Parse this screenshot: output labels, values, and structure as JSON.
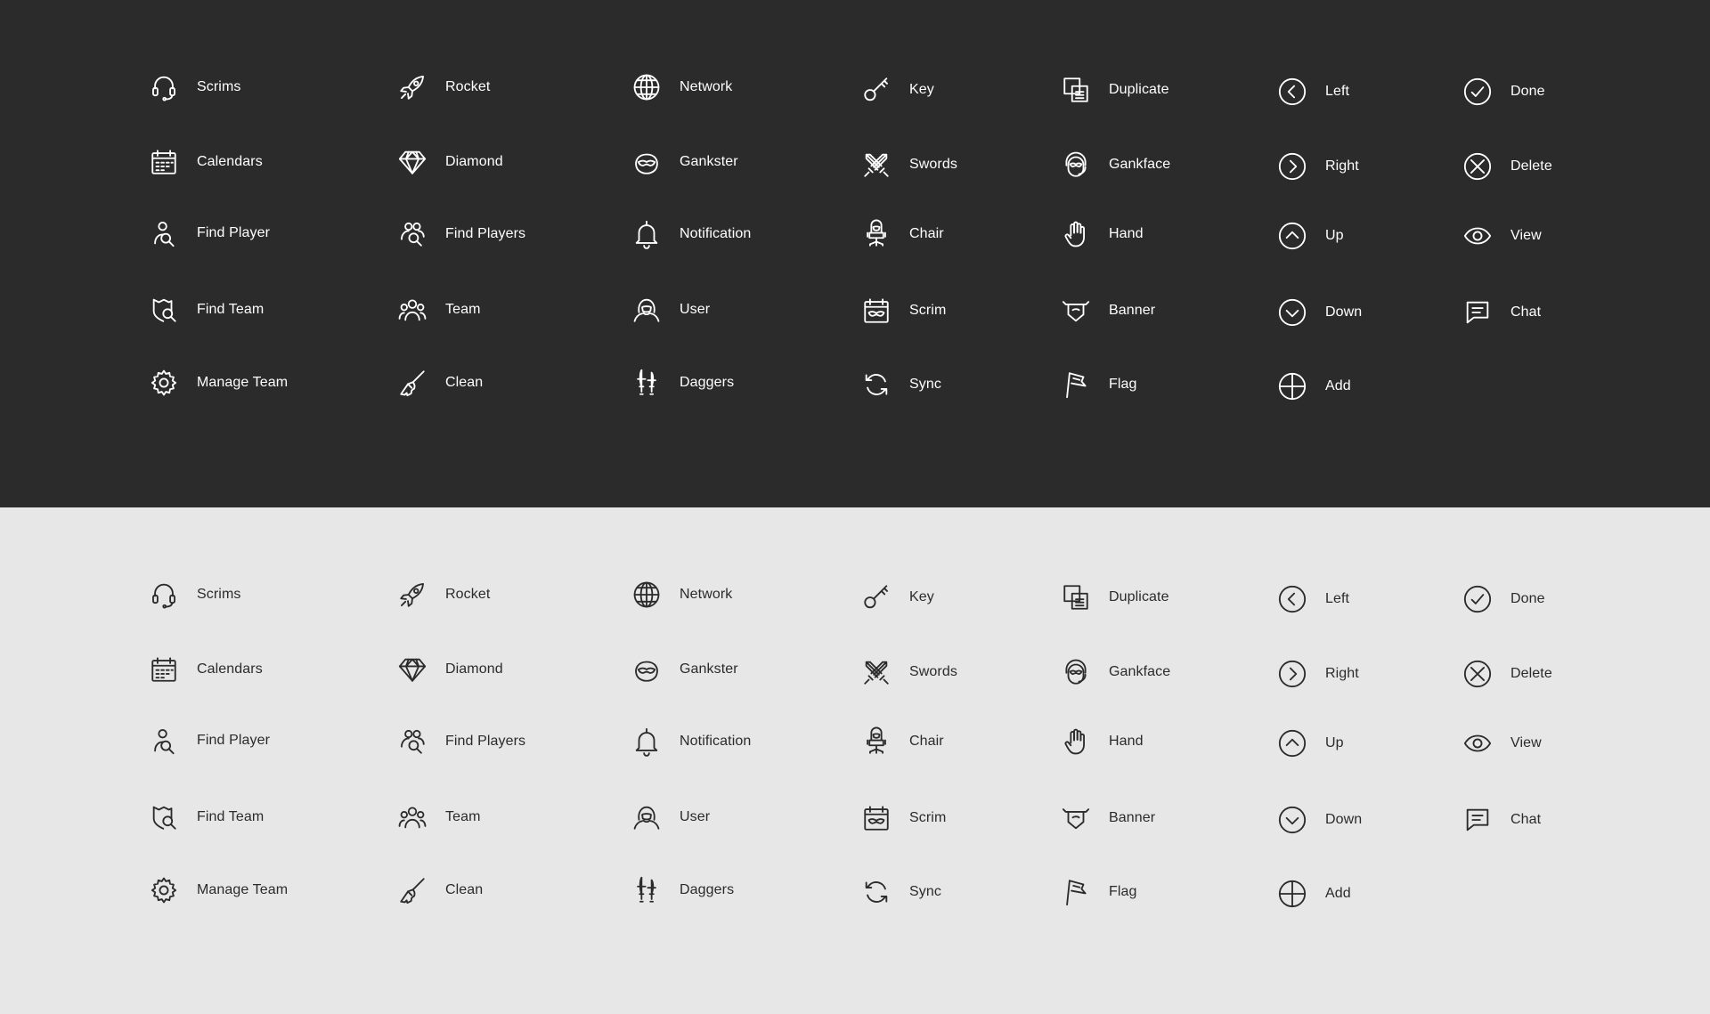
{
  "colors": {
    "dark_background": "#2b2b2b",
    "dark_foreground": "#ffffff",
    "light_background": "#e7e7e7",
    "light_foreground": "#2b2b2b"
  },
  "panels": [
    {
      "theme": "dark"
    },
    {
      "theme": "light"
    }
  ],
  "columns": [
    [
      {
        "label": "Scrims",
        "icon": "headset-icon"
      },
      {
        "label": "Calendars",
        "icon": "calendar-icon"
      },
      {
        "label": "Find Player",
        "icon": "find-player-icon"
      },
      {
        "label": "Find Team",
        "icon": "find-team-icon"
      },
      {
        "label": "Manage Team",
        "icon": "gear-icon"
      }
    ],
    [
      {
        "label": "Rocket",
        "icon": "rocket-icon"
      },
      {
        "label": "Diamond",
        "icon": "diamond-icon"
      },
      {
        "label": "Find Players",
        "icon": "find-players-icon"
      },
      {
        "label": "Team",
        "icon": "team-icon"
      },
      {
        "label": "Clean",
        "icon": "broom-icon"
      }
    ],
    [
      {
        "label": "Network",
        "icon": "globe-icon"
      },
      {
        "label": "Gankster",
        "icon": "gankster-mask-icon"
      },
      {
        "label": "Notification",
        "icon": "bell-icon"
      },
      {
        "label": "User",
        "icon": "user-hood-icon"
      },
      {
        "label": "Daggers",
        "icon": "daggers-icon"
      }
    ],
    [
      {
        "label": "Key",
        "icon": "key-icon"
      },
      {
        "label": "Swords",
        "icon": "swords-icon"
      },
      {
        "label": "Chair",
        "icon": "chair-icon"
      },
      {
        "label": "Scrim",
        "icon": "scrim-calendar-icon"
      },
      {
        "label": "Sync",
        "icon": "sync-icon"
      }
    ],
    [
      {
        "label": "Duplicate",
        "icon": "duplicate-icon"
      },
      {
        "label": "Gankface",
        "icon": "gankface-icon"
      },
      {
        "label": "Hand",
        "icon": "hand-icon"
      },
      {
        "label": "Banner",
        "icon": "banner-icon"
      },
      {
        "label": "Flag",
        "icon": "flag-icon"
      }
    ],
    [
      {
        "label": "Left",
        "icon": "chevron-left-circle-icon"
      },
      {
        "label": "Right",
        "icon": "chevron-right-circle-icon"
      },
      {
        "label": "Up",
        "icon": "chevron-up-circle-icon"
      },
      {
        "label": "Down",
        "icon": "chevron-down-circle-icon"
      },
      {
        "label": "Add",
        "icon": "plus-circle-icon"
      }
    ],
    [
      {
        "label": "Done",
        "icon": "check-circle-icon"
      },
      {
        "label": "Delete",
        "icon": "x-circle-icon"
      },
      {
        "label": "View",
        "icon": "eye-icon"
      },
      {
        "label": "Chat",
        "icon": "chat-icon"
      }
    ]
  ]
}
